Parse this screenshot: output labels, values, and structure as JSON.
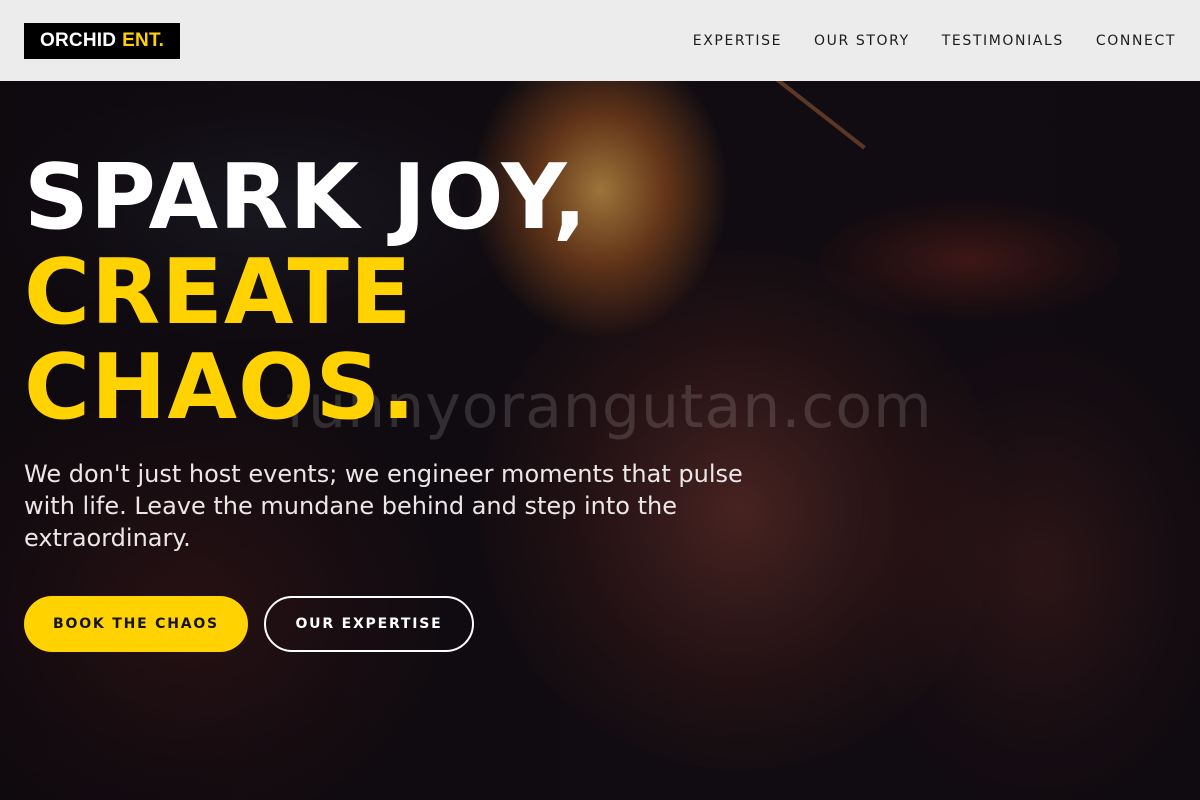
{
  "header": {
    "logo_primary": "ORCHID",
    "logo_accent": "ENT.",
    "nav": [
      {
        "label": "EXPERTISE"
      },
      {
        "label": "OUR STORY"
      },
      {
        "label": "TESTIMONIALS"
      },
      {
        "label": "CONNECT"
      }
    ]
  },
  "hero": {
    "headline_line1": "SPARK JOY,",
    "headline_line2": "CREATE",
    "headline_line3": "CHAOS.",
    "subtext": "We don't just host events; we engineer moments that pulse with life. Leave the mundane behind and step into the extraordinary.",
    "primary_button": "BOOK THE CHAOS",
    "secondary_button": "OUR EXPERTISE",
    "watermark": "funnyorangutan.com"
  },
  "colors": {
    "accent": "#ffd200",
    "header_bg": "#ececec",
    "logo_bg": "#000000",
    "text_light": "#ffffff"
  }
}
